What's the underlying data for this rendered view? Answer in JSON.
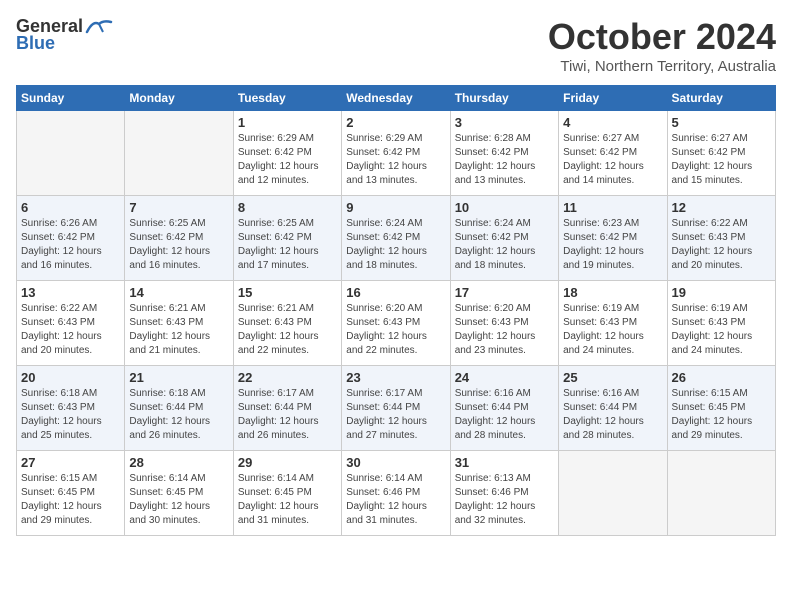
{
  "logo": {
    "general": "General",
    "blue": "Blue"
  },
  "title": "October 2024",
  "subtitle": "Tiwi, Northern Territory, Australia",
  "days_of_week": [
    "Sunday",
    "Monday",
    "Tuesday",
    "Wednesday",
    "Thursday",
    "Friday",
    "Saturday"
  ],
  "weeks": [
    [
      {
        "day": "",
        "sunrise": "",
        "sunset": "",
        "daylight": "",
        "empty": true
      },
      {
        "day": "",
        "sunrise": "",
        "sunset": "",
        "daylight": "",
        "empty": true
      },
      {
        "day": "1",
        "sunrise": "Sunrise: 6:29 AM",
        "sunset": "Sunset: 6:42 PM",
        "daylight": "Daylight: 12 hours and 12 minutes.",
        "empty": false
      },
      {
        "day": "2",
        "sunrise": "Sunrise: 6:29 AM",
        "sunset": "Sunset: 6:42 PM",
        "daylight": "Daylight: 12 hours and 13 minutes.",
        "empty": false
      },
      {
        "day": "3",
        "sunrise": "Sunrise: 6:28 AM",
        "sunset": "Sunset: 6:42 PM",
        "daylight": "Daylight: 12 hours and 13 minutes.",
        "empty": false
      },
      {
        "day": "4",
        "sunrise": "Sunrise: 6:27 AM",
        "sunset": "Sunset: 6:42 PM",
        "daylight": "Daylight: 12 hours and 14 minutes.",
        "empty": false
      },
      {
        "day": "5",
        "sunrise": "Sunrise: 6:27 AM",
        "sunset": "Sunset: 6:42 PM",
        "daylight": "Daylight: 12 hours and 15 minutes.",
        "empty": false
      }
    ],
    [
      {
        "day": "6",
        "sunrise": "Sunrise: 6:26 AM",
        "sunset": "Sunset: 6:42 PM",
        "daylight": "Daylight: 12 hours and 16 minutes.",
        "empty": false
      },
      {
        "day": "7",
        "sunrise": "Sunrise: 6:25 AM",
        "sunset": "Sunset: 6:42 PM",
        "daylight": "Daylight: 12 hours and 16 minutes.",
        "empty": false
      },
      {
        "day": "8",
        "sunrise": "Sunrise: 6:25 AM",
        "sunset": "Sunset: 6:42 PM",
        "daylight": "Daylight: 12 hours and 17 minutes.",
        "empty": false
      },
      {
        "day": "9",
        "sunrise": "Sunrise: 6:24 AM",
        "sunset": "Sunset: 6:42 PM",
        "daylight": "Daylight: 12 hours and 18 minutes.",
        "empty": false
      },
      {
        "day": "10",
        "sunrise": "Sunrise: 6:24 AM",
        "sunset": "Sunset: 6:42 PM",
        "daylight": "Daylight: 12 hours and 18 minutes.",
        "empty": false
      },
      {
        "day": "11",
        "sunrise": "Sunrise: 6:23 AM",
        "sunset": "Sunset: 6:42 PM",
        "daylight": "Daylight: 12 hours and 19 minutes.",
        "empty": false
      },
      {
        "day": "12",
        "sunrise": "Sunrise: 6:22 AM",
        "sunset": "Sunset: 6:43 PM",
        "daylight": "Daylight: 12 hours and 20 minutes.",
        "empty": false
      }
    ],
    [
      {
        "day": "13",
        "sunrise": "Sunrise: 6:22 AM",
        "sunset": "Sunset: 6:43 PM",
        "daylight": "Daylight: 12 hours and 20 minutes.",
        "empty": false
      },
      {
        "day": "14",
        "sunrise": "Sunrise: 6:21 AM",
        "sunset": "Sunset: 6:43 PM",
        "daylight": "Daylight: 12 hours and 21 minutes.",
        "empty": false
      },
      {
        "day": "15",
        "sunrise": "Sunrise: 6:21 AM",
        "sunset": "Sunset: 6:43 PM",
        "daylight": "Daylight: 12 hours and 22 minutes.",
        "empty": false
      },
      {
        "day": "16",
        "sunrise": "Sunrise: 6:20 AM",
        "sunset": "Sunset: 6:43 PM",
        "daylight": "Daylight: 12 hours and 22 minutes.",
        "empty": false
      },
      {
        "day": "17",
        "sunrise": "Sunrise: 6:20 AM",
        "sunset": "Sunset: 6:43 PM",
        "daylight": "Daylight: 12 hours and 23 minutes.",
        "empty": false
      },
      {
        "day": "18",
        "sunrise": "Sunrise: 6:19 AM",
        "sunset": "Sunset: 6:43 PM",
        "daylight": "Daylight: 12 hours and 24 minutes.",
        "empty": false
      },
      {
        "day": "19",
        "sunrise": "Sunrise: 6:19 AM",
        "sunset": "Sunset: 6:43 PM",
        "daylight": "Daylight: 12 hours and 24 minutes.",
        "empty": false
      }
    ],
    [
      {
        "day": "20",
        "sunrise": "Sunrise: 6:18 AM",
        "sunset": "Sunset: 6:43 PM",
        "daylight": "Daylight: 12 hours and 25 minutes.",
        "empty": false
      },
      {
        "day": "21",
        "sunrise": "Sunrise: 6:18 AM",
        "sunset": "Sunset: 6:44 PM",
        "daylight": "Daylight: 12 hours and 26 minutes.",
        "empty": false
      },
      {
        "day": "22",
        "sunrise": "Sunrise: 6:17 AM",
        "sunset": "Sunset: 6:44 PM",
        "daylight": "Daylight: 12 hours and 26 minutes.",
        "empty": false
      },
      {
        "day": "23",
        "sunrise": "Sunrise: 6:17 AM",
        "sunset": "Sunset: 6:44 PM",
        "daylight": "Daylight: 12 hours and 27 minutes.",
        "empty": false
      },
      {
        "day": "24",
        "sunrise": "Sunrise: 6:16 AM",
        "sunset": "Sunset: 6:44 PM",
        "daylight": "Daylight: 12 hours and 28 minutes.",
        "empty": false
      },
      {
        "day": "25",
        "sunrise": "Sunrise: 6:16 AM",
        "sunset": "Sunset: 6:44 PM",
        "daylight": "Daylight: 12 hours and 28 minutes.",
        "empty": false
      },
      {
        "day": "26",
        "sunrise": "Sunrise: 6:15 AM",
        "sunset": "Sunset: 6:45 PM",
        "daylight": "Daylight: 12 hours and 29 minutes.",
        "empty": false
      }
    ],
    [
      {
        "day": "27",
        "sunrise": "Sunrise: 6:15 AM",
        "sunset": "Sunset: 6:45 PM",
        "daylight": "Daylight: 12 hours and 29 minutes.",
        "empty": false
      },
      {
        "day": "28",
        "sunrise": "Sunrise: 6:14 AM",
        "sunset": "Sunset: 6:45 PM",
        "daylight": "Daylight: 12 hours and 30 minutes.",
        "empty": false
      },
      {
        "day": "29",
        "sunrise": "Sunrise: 6:14 AM",
        "sunset": "Sunset: 6:45 PM",
        "daylight": "Daylight: 12 hours and 31 minutes.",
        "empty": false
      },
      {
        "day": "30",
        "sunrise": "Sunrise: 6:14 AM",
        "sunset": "Sunset: 6:46 PM",
        "daylight": "Daylight: 12 hours and 31 minutes.",
        "empty": false
      },
      {
        "day": "31",
        "sunrise": "Sunrise: 6:13 AM",
        "sunset": "Sunset: 6:46 PM",
        "daylight": "Daylight: 12 hours and 32 minutes.",
        "empty": false
      },
      {
        "day": "",
        "sunrise": "",
        "sunset": "",
        "daylight": "",
        "empty": true
      },
      {
        "day": "",
        "sunrise": "",
        "sunset": "",
        "daylight": "",
        "empty": true
      }
    ]
  ]
}
